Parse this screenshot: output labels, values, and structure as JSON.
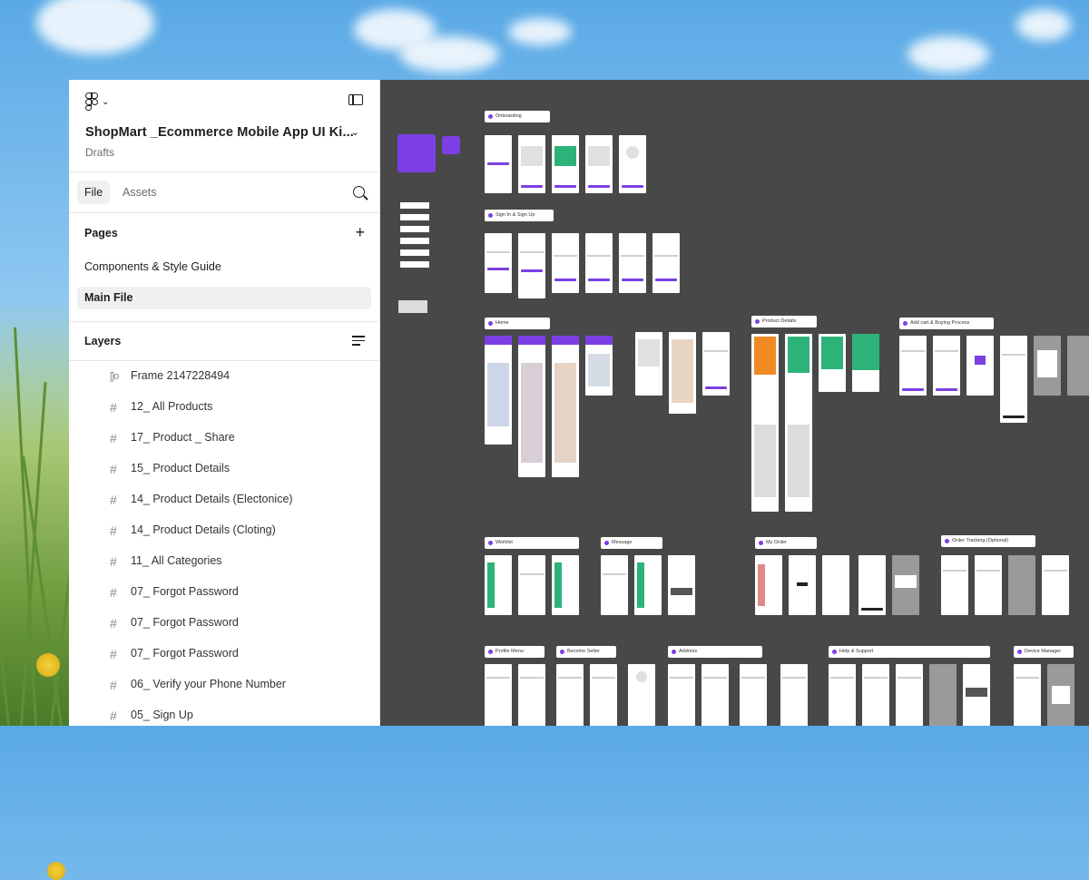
{
  "header": {
    "file_title": "ShopMart _Ecommerce Mobile App UI Ki...",
    "subtitle": "Drafts"
  },
  "tabs": [
    {
      "label": "File",
      "selected": true
    },
    {
      "label": "Assets",
      "selected": false
    }
  ],
  "pages": {
    "title": "Pages",
    "items": [
      {
        "label": "Components & Style Guide",
        "selected": false
      },
      {
        "label": "Main File",
        "selected": true
      }
    ]
  },
  "layers": {
    "title": "Layers",
    "items": [
      {
        "label": "Frame 2147228494",
        "icon": "frame-icon"
      },
      {
        "label": "12_ All Products",
        "icon": "hash-icon"
      },
      {
        "label": "17_ Product _ Share",
        "icon": "hash-icon"
      },
      {
        "label": "15_ Product Details",
        "icon": "hash-icon"
      },
      {
        "label": "14_ Product Details (Electonice)",
        "icon": "hash-icon"
      },
      {
        "label": "14_ Product Details (Cloting)",
        "icon": "hash-icon"
      },
      {
        "label": "11_ All Categories",
        "icon": "hash-icon"
      },
      {
        "label": "07_ Forgot Password",
        "icon": "hash-icon"
      },
      {
        "label": "07_ Forgot Password",
        "icon": "hash-icon"
      },
      {
        "label": "07_ Forgot Password",
        "icon": "hash-icon"
      },
      {
        "label": "06_ Verify your Phone Number",
        "icon": "hash-icon"
      },
      {
        "label": "05_ Sign Up",
        "icon": "hash-icon"
      }
    ]
  },
  "canvas": {
    "sections": [
      {
        "label": "Onboarding"
      },
      {
        "label": "Sign In & Sign Up"
      },
      {
        "label": "Home"
      },
      {
        "label": "Product Details"
      },
      {
        "label": "Add cart & Buying Process"
      },
      {
        "label": "Wishlist"
      },
      {
        "label": "Message"
      },
      {
        "label": "My Order"
      },
      {
        "label": "Order Tracking (Optional)"
      },
      {
        "label": "Profile Menu"
      },
      {
        "label": "Become Seller"
      },
      {
        "label": "Address"
      },
      {
        "label": "Help & Support"
      },
      {
        "label": "Device Manager"
      }
    ]
  },
  "colors": {
    "accent": "#7b3fe4",
    "canvas_bg": "#484848",
    "panel_bg": "#ffffff"
  }
}
